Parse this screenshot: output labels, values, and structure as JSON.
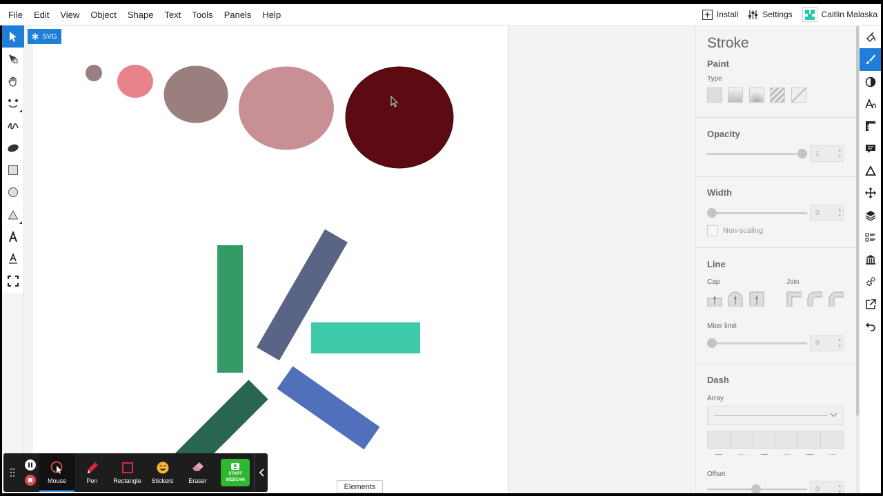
{
  "menubar": {
    "items": [
      "File",
      "Edit",
      "View",
      "Object",
      "Shape",
      "Text",
      "Tools",
      "Panels",
      "Help"
    ],
    "install_label": "Install",
    "settings_label": "Settings",
    "user_name": "Caitlin Malaska"
  },
  "canvas": {
    "badge_label": "SVG",
    "circles": [
      {
        "color": "#998080"
      },
      {
        "color": "#e8828b"
      },
      {
        "color": "#9a7f7f"
      },
      {
        "color": "#c88f94"
      },
      {
        "color": "#5c0b12"
      }
    ],
    "rects": [
      {
        "color": "#339b66"
      },
      {
        "color": "#5a6585"
      },
      {
        "color": "#3ccaa8"
      },
      {
        "color": "#5170bb"
      },
      {
        "color": "#2a6452"
      }
    ]
  },
  "stroke_panel": {
    "title": "Stroke",
    "paint": {
      "heading": "Paint",
      "type_label": "Type"
    },
    "opacity": {
      "heading": "Opacity",
      "value": "1",
      "level": 1
    },
    "width": {
      "heading": "Width",
      "value": "0",
      "level": 0,
      "nonscaling_label": "Non-scaling"
    },
    "line": {
      "heading": "Line",
      "cap_label": "Cap",
      "join_label": "Join",
      "miter_label": "Miter limit",
      "miter_value": "0"
    },
    "dash": {
      "heading": "Dash",
      "array_label": "Array",
      "offset_label": "Offset",
      "offset_value": "0"
    }
  },
  "recorder": {
    "tools": [
      "Mouse",
      "Pen",
      "Rectangle",
      "Stickers",
      "Eraser"
    ],
    "webcam_line1": "START",
    "webcam_line2": "WEBCAM"
  },
  "elements_tab": "Elements"
}
